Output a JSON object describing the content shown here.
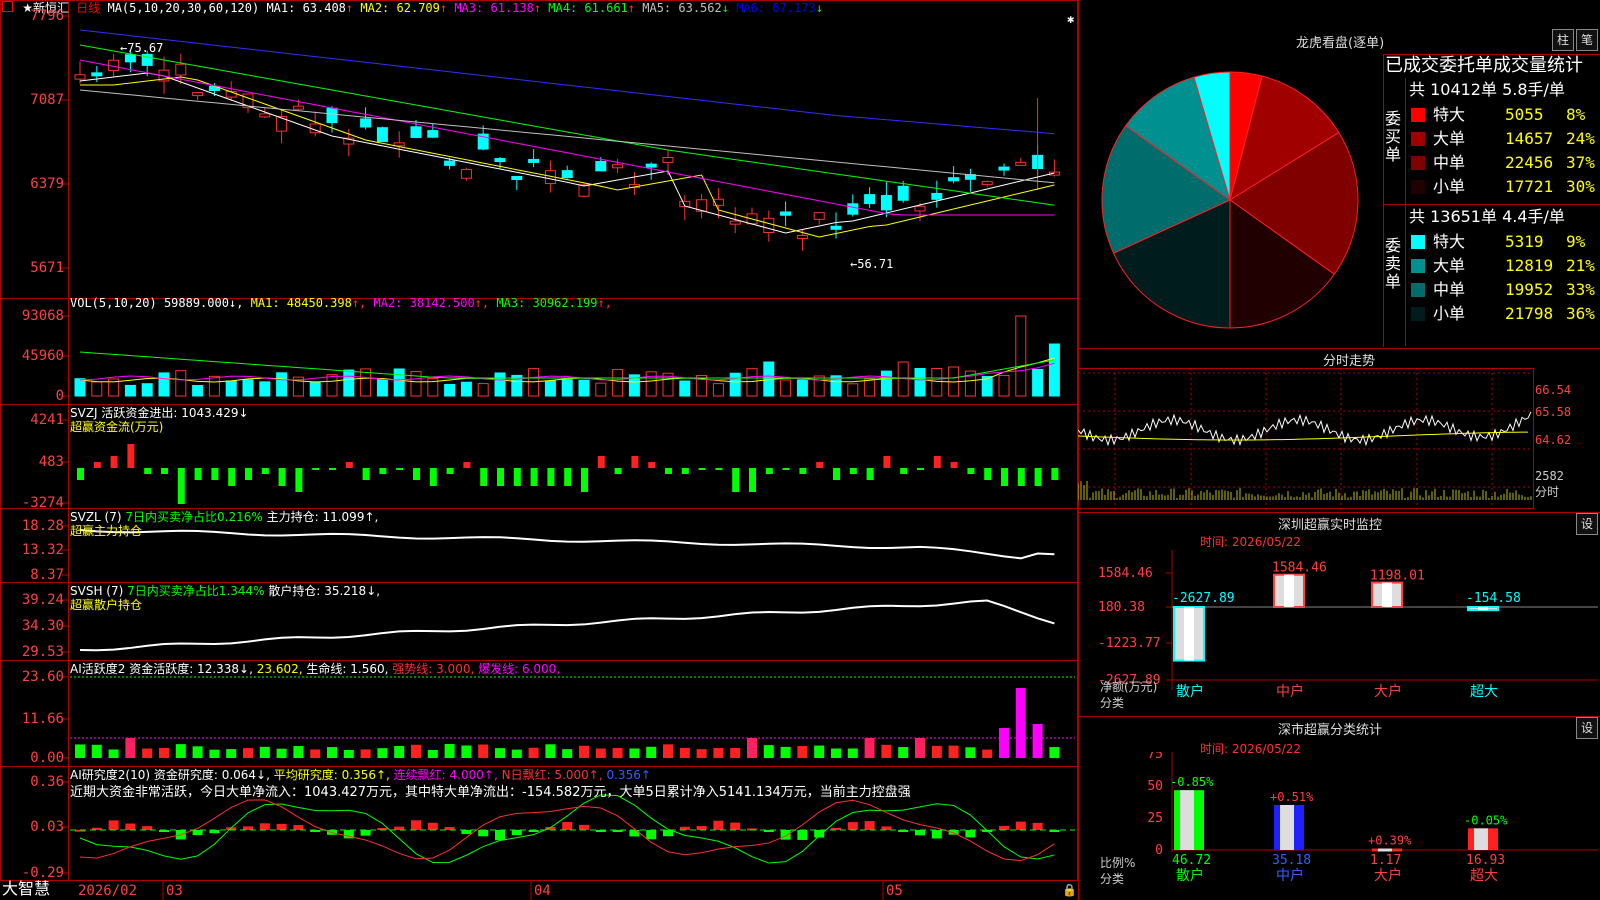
{
  "app": {
    "name": "大智慧",
    "stock": "★新恒汇",
    "period": "日线"
  },
  "main_chart": {
    "indicator": "MA(5,10,20,30,60,120)",
    "ma": [
      {
        "label": "MA1:",
        "value": "63.408",
        "arrow": "↑",
        "color": "#ffffff"
      },
      {
        "label": "MA2:",
        "value": "62.709",
        "arrow": "↑",
        "color": "#ffff00"
      },
      {
        "label": "MA3:",
        "value": "61.138",
        "arrow": "↑",
        "color": "#ff00ff"
      },
      {
        "label": "MA4:",
        "value": "61.661",
        "arrow": "↑",
        "color": "#00ff00"
      },
      {
        "label": "MA5:",
        "value": "63.562",
        "arrow": "↓",
        "color": "#c0c0c0"
      },
      {
        "label": "MA6:",
        "value": "67.173",
        "arrow": "↓",
        "color": "#0000ff"
      }
    ],
    "y_ticks": [
      "7796",
      "7087",
      "6379",
      "5671"
    ],
    "high_label": "75.67",
    "low_label": "56.71"
  },
  "vol_chart": {
    "indicator": "VOL(5,10,20)",
    "value": "59889.000",
    "arrow": "↓",
    "ma": [
      {
        "label": "MA1:",
        "value": "48450.398",
        "arrow": "↑",
        "color": "#ffff00"
      },
      {
        "label": "MA2:",
        "value": "38142.500",
        "arrow": "↑",
        "color": "#ff00ff"
      },
      {
        "label": "MA3:",
        "value": "30962.199",
        "arrow": "↑",
        "color": "#00ff00"
      }
    ],
    "y_ticks": [
      "93068",
      "45960",
      "0"
    ]
  },
  "svzj": {
    "line1": "SVZJ  活跃资金进出: 1043.429↓",
    "line2": "超赢资金流(万元)",
    "y_ticks": [
      "4241",
      "483",
      "-3274"
    ]
  },
  "svzl": {
    "name": "SVZL (7)",
    "desc": "7日内买卖净占比0.216%",
    "hold": "主力持仓: 11.099↑,",
    "line2": "超赢主力持仓",
    "y_ticks": [
      "18.28",
      "13.32",
      "8.37"
    ]
  },
  "svsh": {
    "name": "SVSH (7)",
    "desc": "7日内买卖净占比1.344%",
    "hold": "散户持仓: 35.218↓,",
    "line2": "超赢散户持仓",
    "y_ticks": [
      "39.24",
      "34.30",
      "29.53"
    ]
  },
  "ai_active": {
    "label": "AI活跃度2 资金活跃度: 12.338↓,",
    "v2": "23.602,",
    "v3": "生命线: 1.560,",
    "v4": "强势线: 3.000,",
    "v5": "爆发线: 6.000,",
    "y_ticks": [
      "23.60",
      "11.66",
      "0.00"
    ]
  },
  "ai_research": {
    "label": "AI研究度2(10) 资金研究度: 0.064↓,",
    "v2": "平均研究度: 0.356↑,",
    "v3": "连续飘红: 4.000↑,",
    "v4": "N日飘红: 5.000↑,",
    "v5": "0.356↑",
    "summary": "近期大资金非常活跃，今日大单净流入：1043.427万元，其中特大单净流出：-154.582万元，大单5日累计净入5141.134万元，当前主力控盘强",
    "y_ticks": [
      "0.36",
      "0.03",
      "-0.29"
    ]
  },
  "x_axis": {
    "labels": [
      "2026/02",
      "03",
      "04",
      "05"
    ]
  },
  "dragon": {
    "title": "龙虎看盘(逐单)",
    "btn1": "柱",
    "btn2": "笔",
    "subtitle": "已成交委托单成交量统计",
    "buy_header": "共 10412单 5.8手/单",
    "buy_side": "委买单",
    "sell_header": "共 13651单 4.4手/单",
    "sell_side": "委卖单",
    "buy": [
      {
        "label": "特大",
        "vol": "5055",
        "pct": "8%",
        "color": "#ff0000"
      },
      {
        "label": "大单",
        "vol": "14657",
        "pct": "24%",
        "color": "#a00000"
      },
      {
        "label": "中单",
        "vol": "22456",
        "pct": "37%",
        "color": "#800000"
      },
      {
        "label": "小单",
        "vol": "17721",
        "pct": "30%",
        "color": "#200000"
      }
    ],
    "sell": [
      {
        "label": "特大",
        "vol": "5319",
        "pct": "9%",
        "color": "#00ffff"
      },
      {
        "label": "大单",
        "vol": "12819",
        "pct": "21%",
        "color": "#009090"
      },
      {
        "label": "中单",
        "vol": "19952",
        "pct": "33%",
        "color": "#006c6c"
      },
      {
        "label": "小单",
        "vol": "21798",
        "pct": "36%",
        "color": "#001c1c"
      }
    ]
  },
  "intraday": {
    "title": "分时走势",
    "y_ticks": [
      "66.54",
      "65.58",
      "64.62"
    ],
    "vol_tick": "2582",
    "vol_unit": "分时"
  },
  "sz_monitor": {
    "title": "深圳超赢实时监控",
    "btn": "设",
    "date": "时间: 2026/05/22",
    "y_ticks": [
      "1584.46",
      "180.38",
      "-1223.77",
      "-2627.89"
    ],
    "unit1": "净额(万元)",
    "unit2": "分类",
    "bars": [
      {
        "cat": "散户",
        "value": -2627.89,
        "label": "-2627.89"
      },
      {
        "cat": "中户",
        "value": 1584.46,
        "label": "1584.46"
      },
      {
        "cat": "大户",
        "value": 1198.01,
        "label": "1198.01"
      },
      {
        "cat": "超大",
        "value": -154.58,
        "label": "-154.58"
      }
    ]
  },
  "sz_stats": {
    "title": "深市超赢分类统计",
    "btn": "设",
    "date": "时间: 2026/05/22",
    "y_ticks": [
      "75",
      "50",
      "25",
      "0"
    ],
    "unit1": "比例%",
    "unit2": "分类",
    "bars": [
      {
        "cat": "散户",
        "value": 46.72,
        "label": "46.72",
        "chg": "-0.85%"
      },
      {
        "cat": "中户",
        "value": 35.18,
        "label": "35.18",
        "chg": "+0.51%"
      },
      {
        "cat": "大户",
        "value": 1.17,
        "label": "1.17",
        "chg": "+0.39%"
      },
      {
        "cat": "超大",
        "value": 16.93,
        "label": "16.93",
        "chg": "-0.05%"
      }
    ]
  }
}
